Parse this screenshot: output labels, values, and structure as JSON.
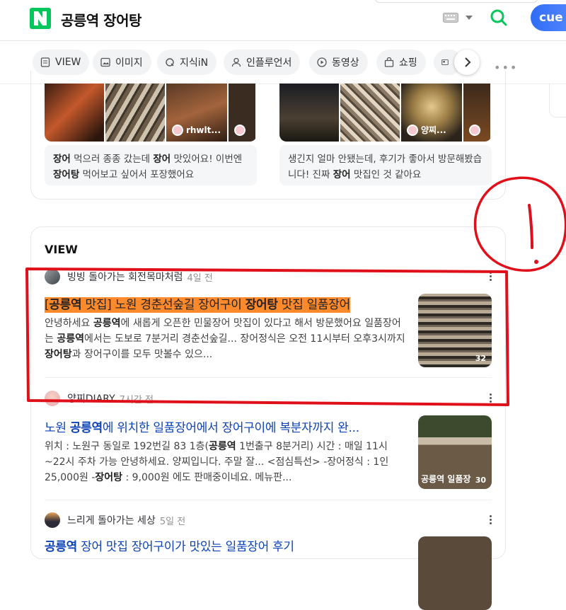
{
  "header": {
    "query": "공릉역 장어탕",
    "cue_label": "cue"
  },
  "tabs": [
    {
      "label": "VIEW",
      "icon": "doc-icon"
    },
    {
      "label": "이미지",
      "icon": "image-icon"
    },
    {
      "label": "지식iN",
      "icon": "q-icon"
    },
    {
      "label": "인플루언서",
      "icon": "person-icon"
    },
    {
      "label": "동영상",
      "icon": "play-icon"
    },
    {
      "label": "쇼핑",
      "icon": "bag-icon"
    }
  ],
  "top_cards": [
    {
      "thumb_user": "rhwlt...",
      "snippet_parts": [
        [
          "장어",
          true
        ],
        [
          " 먹으러 종종 갔는데 ",
          false
        ],
        [
          "장어",
          true
        ],
        [
          " 맛있어요! 이번엔 ",
          false
        ],
        [
          "장어탕",
          true
        ],
        [
          " 먹어보고 싶어서 포장했어요",
          false
        ]
      ]
    },
    {
      "thumb_user": "양찌...",
      "snippet_parts": [
        [
          "생긴지 얼마 안됐는데, 후기가 좋아서 방문해봤습니다! 진짜 ",
          false
        ],
        [
          "장어",
          true
        ],
        [
          " 맛집인 것 같아요",
          false
        ]
      ]
    }
  ],
  "view_section": {
    "title": "VIEW",
    "posts": [
      {
        "author": "빙빙 돌아가는 회전목마처럼",
        "ago": "4일 전",
        "title_parts": [
          [
            "[",
            false
          ],
          [
            "공릉역",
            true
          ],
          [
            " 맛집] 노원 경춘선숲길 장어구이 ",
            false
          ],
          [
            "장어탕",
            true
          ],
          [
            " 맛집 일품장어",
            false
          ]
        ],
        "desc_parts": [
          [
            "안녕하세요 ",
            false
          ],
          [
            "공릉역",
            true
          ],
          [
            "에 새롭게 오픈한 민물장어 맛집이 있다고 해서 방문했어요 일품장어는 ",
            false
          ],
          [
            "공릉역",
            true
          ],
          [
            "에서는 도보로 7분거리 경춘선숲길... 장어정식은 오전 11시부터 오후3시까지 ",
            false
          ],
          [
            "장어탕",
            true
          ],
          [
            "과 장어구이를 모두 맛볼수 있으...",
            false
          ]
        ],
        "img_count": "32"
      },
      {
        "author": "양찌DIARY",
        "ago": "7시간 전",
        "title_parts": [
          [
            "노원 ",
            false
          ],
          [
            "공릉역",
            true
          ],
          [
            "에 위치한 일품장어에서 장어구이에 복분자까지 완...",
            false
          ]
        ],
        "desc_parts": [
          [
            "위치 : 노원구 동일로 192번길 83 1층(",
            false
          ],
          [
            "공릉역",
            true
          ],
          [
            " 1번출구 8분거리) 시간 : 매일 11시~22시 주차 가능 안녕하세요. 양찌입니다. 주말 잘... <점심특선> -장어정식 : 1인 25,000원 -",
            false
          ],
          [
            "장어탕",
            true
          ],
          [
            " : 9,000원 에도 판매중이네요. 메뉴판...",
            false
          ]
        ],
        "img_caption": "공릉역 일품장",
        "img_count": "30"
      },
      {
        "author": "느리게 돌아가는 세상",
        "ago": "5일 전",
        "title_parts": [
          [
            "공릉역",
            true
          ],
          [
            " 장어 맛집 장어구이가 맛있는 일품장어 후기",
            false
          ]
        ]
      }
    ]
  },
  "colors": {
    "brand_green": "#03c75a",
    "link_blue": "#0c43b7",
    "highlight_orange": "#ff8a2b",
    "annotation_red": "#e0101a"
  }
}
